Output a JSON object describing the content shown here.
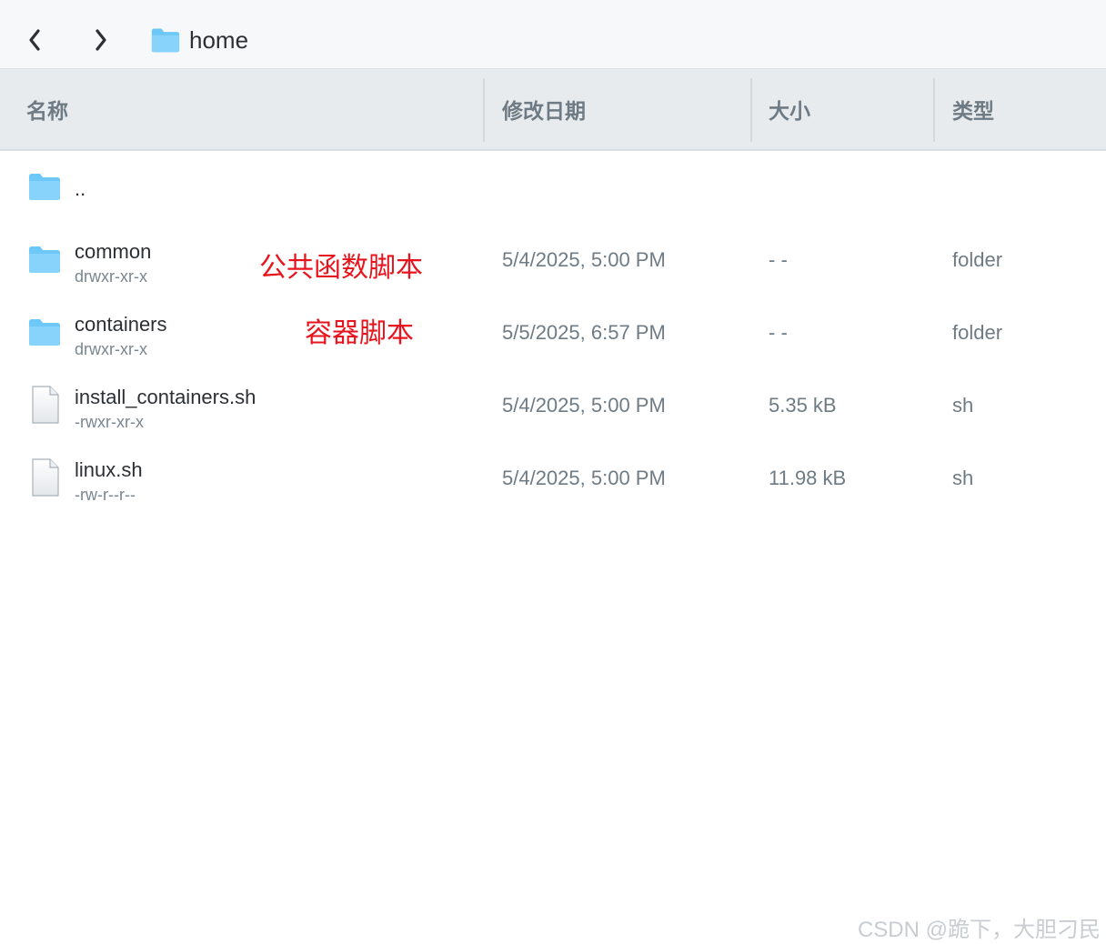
{
  "toolbar": {
    "back_icon": "chevron-left-icon",
    "forward_icon": "chevron-right-icon",
    "breadcrumb_icon": "folder-icon",
    "breadcrumb_label": "home"
  },
  "columns": {
    "name": "名称",
    "modified": "修改日期",
    "size": "大小",
    "type": "类型"
  },
  "colors": {
    "folder": "#6dc7f8",
    "annotation": "#e8141d",
    "header_bg": "#e7ebee"
  },
  "files": [
    {
      "name": "..",
      "perm": "",
      "modified": "",
      "size": "",
      "type": "",
      "icon": "folder-icon"
    },
    {
      "name": "common",
      "perm": "drwxr-xr-x",
      "modified": "5/4/2025, 5:00 PM",
      "size": "- -",
      "type": "folder",
      "icon": "folder-icon",
      "annotation": "公共函数脚本"
    },
    {
      "name": "containers",
      "perm": "drwxr-xr-x",
      "modified": "5/5/2025, 6:57 PM",
      "size": "- -",
      "type": "folder",
      "icon": "folder-icon",
      "annotation": "容器脚本"
    },
    {
      "name": "install_containers.sh",
      "perm": "-rwxr-xr-x",
      "modified": "5/4/2025, 5:00 PM",
      "size": "5.35 kB",
      "type": "sh",
      "icon": "file-icon"
    },
    {
      "name": "linux.sh",
      "perm": "-rw-r--r--",
      "modified": "5/4/2025, 5:00 PM",
      "size": "11.98 kB",
      "type": "sh",
      "icon": "file-icon"
    }
  ],
  "watermark": "CSDN @跪下，大胆刁民"
}
